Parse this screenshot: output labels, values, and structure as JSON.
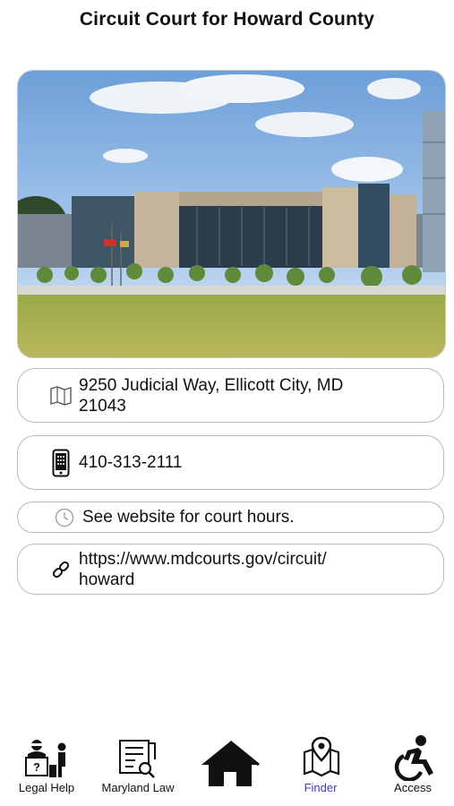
{
  "header": {
    "title": "Circuit Court for Howard County"
  },
  "photo": {
    "alt": "Circuit Court building"
  },
  "info": {
    "address_line1": "9250 Judicial Way, Ellicott City, MD",
    "address_line2": "21043",
    "phone": "410-313-2111",
    "hours": "See website for court hours.",
    "website_line1": "https://www.mdcourts.gov/circuit/",
    "website_line2": "howard"
  },
  "icons": {
    "address": "map-icon",
    "phone": "phone-icon",
    "hours": "clock-icon",
    "website": "link-icon"
  },
  "nav": {
    "items": [
      {
        "label": "Legal Help",
        "icon": "legal-help-icon",
        "active": false
      },
      {
        "label": "Maryland Law",
        "icon": "maryland-law-icon",
        "active": false
      },
      {
        "label": "",
        "icon": "home-icon",
        "active": false
      },
      {
        "label": "Finder",
        "icon": "finder-map-icon",
        "active": true
      },
      {
        "label": "Access",
        "icon": "accessibility-icon",
        "active": false
      }
    ]
  },
  "colors": {
    "accent": "#3a3adb",
    "border": "#b9b9b9"
  }
}
